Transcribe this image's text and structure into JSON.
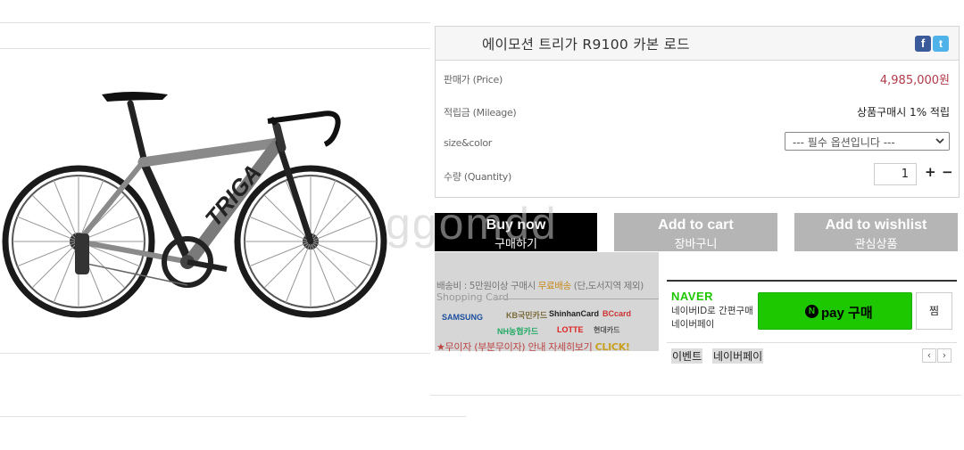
{
  "product": {
    "title": "에이모션 트리가 R9100 카본 로드",
    "price_label": "판매가 (Price)",
    "price": "4,985,000원",
    "mileage_label": "적립금 (Mileage)",
    "mileage": "상품구매시 1% 적립",
    "option_label": "size&color",
    "option_selected": "--- 필수 옵션입니다 ---",
    "qty_label": "수량 (Quantity)",
    "qty": "1",
    "qty_plus": "+",
    "qty_minus": "−",
    "sns": {
      "facebook": "f",
      "twitter": "t"
    }
  },
  "buttons": {
    "buy": {
      "en": "Buy now",
      "ko": "구매하기"
    },
    "cart": {
      "en": "Add to cart",
      "ko": "장바구니"
    },
    "wish": {
      "en": "Add to wishlist",
      "ko": "관심상품"
    }
  },
  "watermark": "ggomdd",
  "shipping": {
    "label": "배송비 : ",
    "text": "5만원이상 구매시 ",
    "free": "무료배송",
    "note": " (단,도서지역 제외)",
    "card_heading": "Shopping Card",
    "cards": [
      "SAMSUNG",
      "KB국민카드",
      "ShinhanCard",
      "BCcard",
      "NH농협카드",
      "LOTTE",
      "현대카드"
    ],
    "interest": "★무이자 (부분무이자) 안내 자세히보기 ",
    "click": "CLICK!"
  },
  "naverpay": {
    "brand": "NAVER",
    "desc1": "네이버ID로 간편구매",
    "desc2": "네이버페이",
    "button": "pay 구매",
    "n": "N",
    "zzim": "찜",
    "event": "이벤트",
    "event2": "네이버페이",
    "prev": "‹",
    "next": "›"
  },
  "colors": {
    "price": "#b13a4b",
    "naver_green": "#1ec800",
    "buy_bg": "#000000",
    "cart_bg": "#b5b5b5"
  }
}
